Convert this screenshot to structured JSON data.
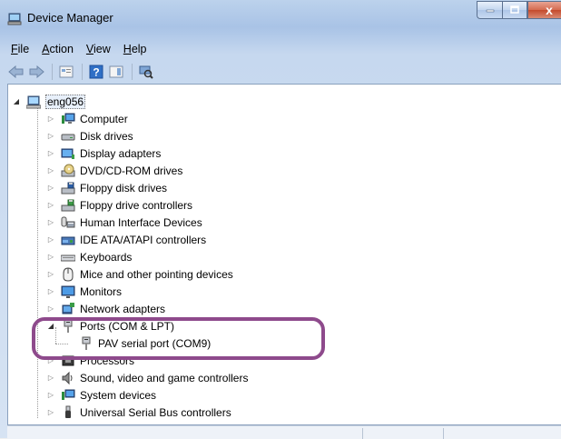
{
  "window": {
    "title": "Device Manager",
    "controls": {
      "minimize": "–",
      "maximize": "□",
      "close": "x"
    }
  },
  "menu": [
    {
      "label": "File",
      "accel": "F",
      "rest": "ile"
    },
    {
      "label": "Action",
      "accel": "A",
      "rest": "ction"
    },
    {
      "label": "View",
      "accel": "V",
      "rest": "iew"
    },
    {
      "label": "Help",
      "accel": "H",
      "rest": "elp"
    }
  ],
  "toolbar": {
    "buttons": [
      "back-icon",
      "forward-icon",
      "properties-icon",
      "help-icon",
      "view-icon",
      "scan-hardware-icon"
    ]
  },
  "tree": {
    "root": {
      "label": "eng056",
      "icon": "computer-root-icon"
    },
    "items": [
      {
        "label": "Computer",
        "icon": "computer-icon"
      },
      {
        "label": "Disk drives",
        "icon": "disk-drive-icon"
      },
      {
        "label": "Display adapters",
        "icon": "display-adapter-icon"
      },
      {
        "label": "DVD/CD-ROM drives",
        "icon": "dvd-drive-icon"
      },
      {
        "label": "Floppy disk drives",
        "icon": "floppy-disk-icon"
      },
      {
        "label": "Floppy drive controllers",
        "icon": "floppy-controller-icon"
      },
      {
        "label": "Human Interface Devices",
        "icon": "hid-icon"
      },
      {
        "label": "IDE ATA/ATAPI controllers",
        "icon": "ide-controller-icon"
      },
      {
        "label": "Keyboards",
        "icon": "keyboard-icon"
      },
      {
        "label": "Mice and other pointing devices",
        "icon": "mouse-icon"
      },
      {
        "label": "Monitors",
        "icon": "monitor-icon"
      },
      {
        "label": "Network adapters",
        "icon": "network-adapter-icon"
      },
      {
        "label": "Ports (COM & LPT)",
        "icon": "port-icon",
        "expanded": true,
        "children": [
          {
            "label": "PAV serial port (COM9)",
            "icon": "serial-port-icon"
          }
        ]
      },
      {
        "label": "Processors",
        "icon": "processor-icon"
      },
      {
        "label": "Sound, video and game controllers",
        "icon": "sound-icon"
      },
      {
        "label": "System devices",
        "icon": "system-device-icon"
      },
      {
        "label": "Universal Serial Bus controllers",
        "icon": "usb-icon"
      }
    ]
  },
  "colors": {
    "highlight": "#8e4a8c",
    "selection": "#e8f0fb"
  }
}
